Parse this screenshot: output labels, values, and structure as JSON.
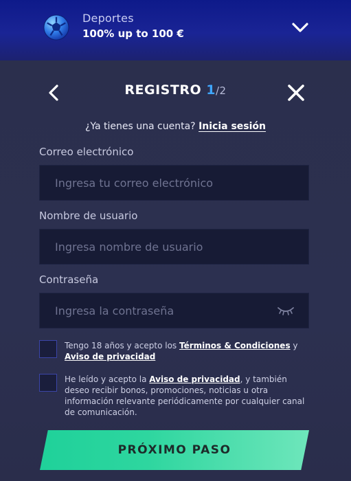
{
  "banner": {
    "category": "Deportes",
    "offer": "100% up to 100 €"
  },
  "header": {
    "title": "REGISTRO",
    "step_current": "1",
    "step_total": "/2"
  },
  "login": {
    "question": "¿Ya tienes una cuenta?",
    "link": "Inicia sesión"
  },
  "form": {
    "email": {
      "label": "Correo electrónico",
      "placeholder": "Ingresa tu correo electrónico",
      "value": ""
    },
    "username": {
      "label": "Nombre de usuario",
      "placeholder": "Ingresa nombre de usuario",
      "value": ""
    },
    "password": {
      "label": "Contraseña",
      "placeholder": "Ingresa la contraseña",
      "value": ""
    }
  },
  "consents": {
    "terms": {
      "prefix": "Tengo 18 años y acepto los ",
      "link1": "Términos & Condiciones",
      "mid": " y ",
      "link2": "Aviso de privacidad",
      "checked": false
    },
    "privacy": {
      "prefix": "He leído y acepto la ",
      "link": "Aviso de privacidad",
      "suffix": ", y también deseo recibir bonos, promociones, noticias u otra información relevante periódicamente por cualquier canal de comunicación.",
      "checked": false
    }
  },
  "actions": {
    "next_label": "PRÓXIMO PASO"
  },
  "icons": {
    "banner": "soccer-ball-icon",
    "expand": "chevron-down-icon",
    "back": "chevron-left-icon",
    "close": "close-icon",
    "password_toggle": "eye-closed-icon"
  },
  "colors": {
    "accent_blue": "#3fa6ff",
    "cta_green": "#2ed69f",
    "banner_blue": "#1a2495",
    "panel_bg": "#2b2f4d",
    "input_bg": "#171b35"
  }
}
